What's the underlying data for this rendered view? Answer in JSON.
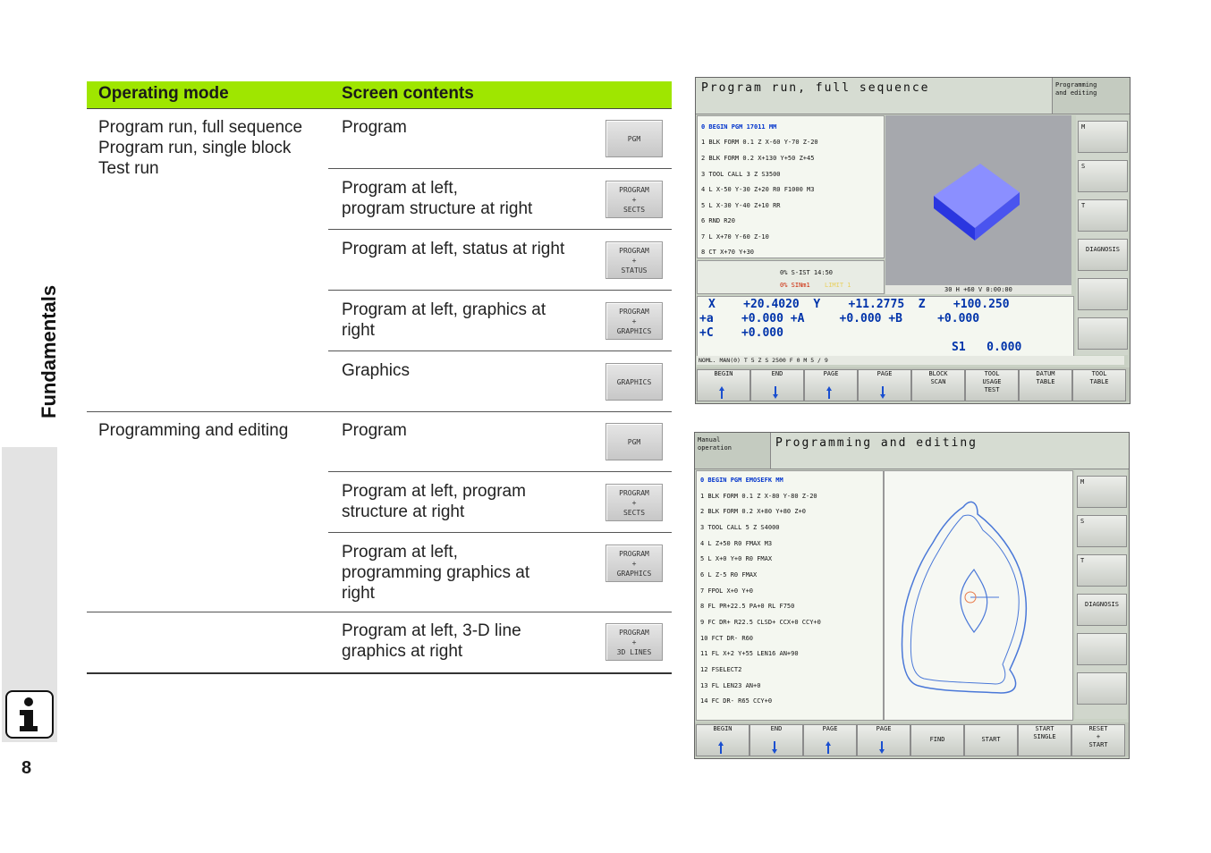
{
  "sidebar": {
    "section_title": "Fundamentals",
    "page_number": "8"
  },
  "table": {
    "headers": [
      "Operating mode",
      "Screen contents"
    ],
    "groups": [
      {
        "modes": [
          "Program run, full sequence",
          "Program run, single block",
          "Test run"
        ]
      },
      {
        "modes": [
          "Programming and editing"
        ]
      }
    ],
    "rows": [
      {
        "content": "Program",
        "key": "PGM"
      },
      {
        "content": "Program at left,\nprogram structure at right",
        "key": "PROGRAM\n+\nSECTS"
      },
      {
        "content": "Program at left, status at right",
        "key": "PROGRAM\n+\nSTATUS"
      },
      {
        "content": "Program at left, graphics at\nright",
        "key": "PROGRAM\n+\nGRAPHICS"
      },
      {
        "content": "Graphics",
        "key": "GRAPHICS"
      },
      {
        "content": "Program",
        "key": "PGM"
      },
      {
        "content": "Program at left, program\nstructure at right",
        "key": "PROGRAM\n+\nSECTS"
      },
      {
        "content": "Program at left,\nprogramming graphics at\nright",
        "key": "PROGRAM\n+\nGRAPHICS"
      },
      {
        "content": "Program at left, 3-D line\ngraphics at right",
        "key": "PROGRAM\n+\n3D LINES"
      }
    ]
  },
  "screen1": {
    "title": "Program run, full sequence",
    "corner": "Programming\nand editing",
    "lines": [
      "0  BEGIN PGM 17011 MM",
      "1  BLK FORM 0.1 Z  X-60  Y-70  Z-20",
      "2  BLK FORM 0.2  X+130  Y+50  Z+45",
      "3  TOOL CALL 3 Z S3500",
      "4  L  X-50  Y-30  Z+20 R0 F1000 M3",
      "5  L  X-30  Y-40  Z+10 RR",
      "6  RND R20",
      "7  L  X+70  Y-60  Z-10",
      "8  CT  X+70  Y+30"
    ],
    "status1": "0% S-IST 14:50",
    "status2": "0% SINm1",
    "status3": "LIMIT 1",
    "graphics_info": "30 H +60 V      0:00:00",
    "positions": [
      "X    +20.4020  Y    +11.2775  Z    +100.250",
      "+a    +0.000 +A     +0.000 +B     +0.000",
      "+C    +0.000"
    ],
    "spindle": "S1   0.000",
    "bar": "NOML.        MAN(0)      T 5         Z S 2500    F 0       M 5 / 9",
    "side_keys": [
      "M",
      "S",
      "T",
      "DIAGNOSIS"
    ],
    "soft_keys": [
      "BEGIN",
      "END",
      "PAGE",
      "PAGE",
      "BLOCK\nSCAN",
      "TOOL\nUSAGE\nTEST",
      "DATUM\nTABLE",
      "TOOL\nTABLE"
    ]
  },
  "screen2": {
    "title": "Programming and editing",
    "corner": "Manual\noperation",
    "lines": [
      "0  BEGIN PGM EMOSEFK MM",
      "1  BLK FORM 0.1 Z  X-80  Y-80  Z-20",
      "2  BLK FORM 0.2  X+80  Y+80  Z+0",
      "3  TOOL CALL 5 Z S4000",
      "4  L  Z+50 R0 FMAX M3",
      "5  L  X+0  Y+0 R0 FMAX",
      "6  L  Z-5 R0 FMAX",
      "7  FPOL  X+0  Y+0",
      "8  FL  PR+22.5  PA+0 RL F750",
      "9  FC DR+ R22.5 CLSD+  CCX+0  CCY+0",
      "10 FCT DR- R60",
      "11 FL  X+2  Y+55 LEN16  AN+90",
      "12 FSELECT2",
      "13 FL LEN23  AN+0",
      "14 FC DR- R65  CCY+0"
    ],
    "side_keys": [
      "M",
      "S",
      "T",
      "DIAGNOSIS"
    ],
    "soft_keys": [
      "BEGIN",
      "END",
      "PAGE",
      "PAGE",
      "FIND",
      "START",
      "START\nSINGLE",
      "RESET\n+\nSTART"
    ]
  }
}
